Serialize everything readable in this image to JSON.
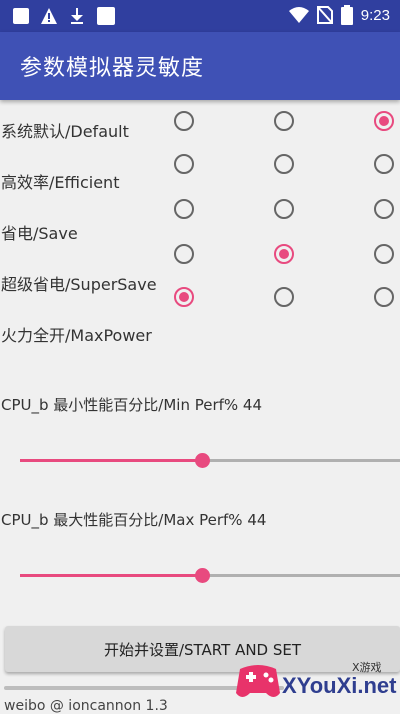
{
  "status_bar": {
    "time": "9:23",
    "left_icons": [
      "square-notification-icon",
      "warning-icon",
      "download-icon",
      "square-notification-icon"
    ],
    "right_icons": [
      "wifi-icon",
      "no-sim-icon",
      "battery-icon"
    ]
  },
  "app_bar": {
    "title": "参数模拟器灵敏度"
  },
  "modes": [
    {
      "label": "系统默认/Default",
      "selected_column": 3
    },
    {
      "label": "高效率/Efficient",
      "selected_column": 0
    },
    {
      "label": "省电/Save",
      "selected_column": 0
    },
    {
      "label": "超级省电/SuperSave",
      "selected_column": 2
    },
    {
      "label": "火力全开/MaxPower",
      "selected_column": 1
    }
  ],
  "sliders": {
    "min": {
      "label": "CPU_b 最小性能百分比/Min Perf% 44",
      "value_fraction": 0.48
    },
    "max": {
      "label": "CPU_b 最大性能百分比/Max Perf% 44",
      "value_fraction": 0.48
    }
  },
  "start_button": {
    "label": "开始并设置/START AND SET"
  },
  "footer": {
    "text": "weibo @ ioncannon 1.3"
  },
  "watermark": {
    "text": "XYouXi.net",
    "small": "X游戏"
  },
  "colors": {
    "status_bar": "#303f9f",
    "app_bar": "#3f51b5",
    "accent": "#e84a7f",
    "background": "#f0f0f0"
  }
}
